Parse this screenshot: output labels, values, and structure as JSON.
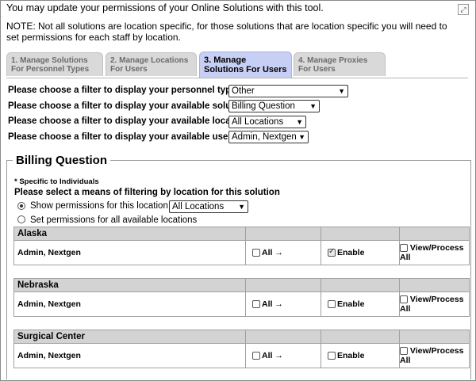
{
  "intro": "You may update your permissions of your Online Solutions with this tool.",
  "note": "NOTE: Not all solutions are location specific, for those solutions that are location specific you will need to set permissions for each staff by location.",
  "tabs": [
    {
      "label": "1. Manage Solutions For Personnel Types",
      "active": false
    },
    {
      "label": "2. Manage Locations For Users",
      "active": false
    },
    {
      "label": "3. Manage Solutions For Users",
      "active": true
    },
    {
      "label": "4. Manage Proxies For Users",
      "active": false
    }
  ],
  "filters": [
    {
      "label": "Please choose a filter to display your personnel types *",
      "value": "Other"
    },
    {
      "label": "Please choose a filter to display your available solutions",
      "value": "Billing Question"
    },
    {
      "label": "Please choose a filter to display your available locations",
      "value": "All Locations"
    },
    {
      "label": "Please choose a filter to display your available users",
      "value": "Admin, Nextgen"
    }
  ],
  "section": {
    "title": "Billing Question",
    "specific_note": "* Specific to Individuals",
    "means_label": "Please select a means of filtering by location for this solution",
    "option_show": "Show permissions for this location",
    "option_show_value": "All Locations",
    "option_all": "Set permissions for all available locations"
  },
  "columns": {
    "all": "All →",
    "enable": "Enable",
    "view_process": "View/Process",
    "view_process_all": "All"
  },
  "locations": [
    {
      "name": "Alaska",
      "user": "Admin, Nextgen",
      "all_checked": false,
      "enable_checked": true,
      "view_checked": false
    },
    {
      "name": "Nebraska",
      "user": "Admin, Nextgen",
      "all_checked": false,
      "enable_checked": false,
      "view_checked": false
    },
    {
      "name": "Surgical Center",
      "user": "Admin, Nextgen",
      "all_checked": false,
      "enable_checked": false,
      "view_checked": false
    }
  ]
}
